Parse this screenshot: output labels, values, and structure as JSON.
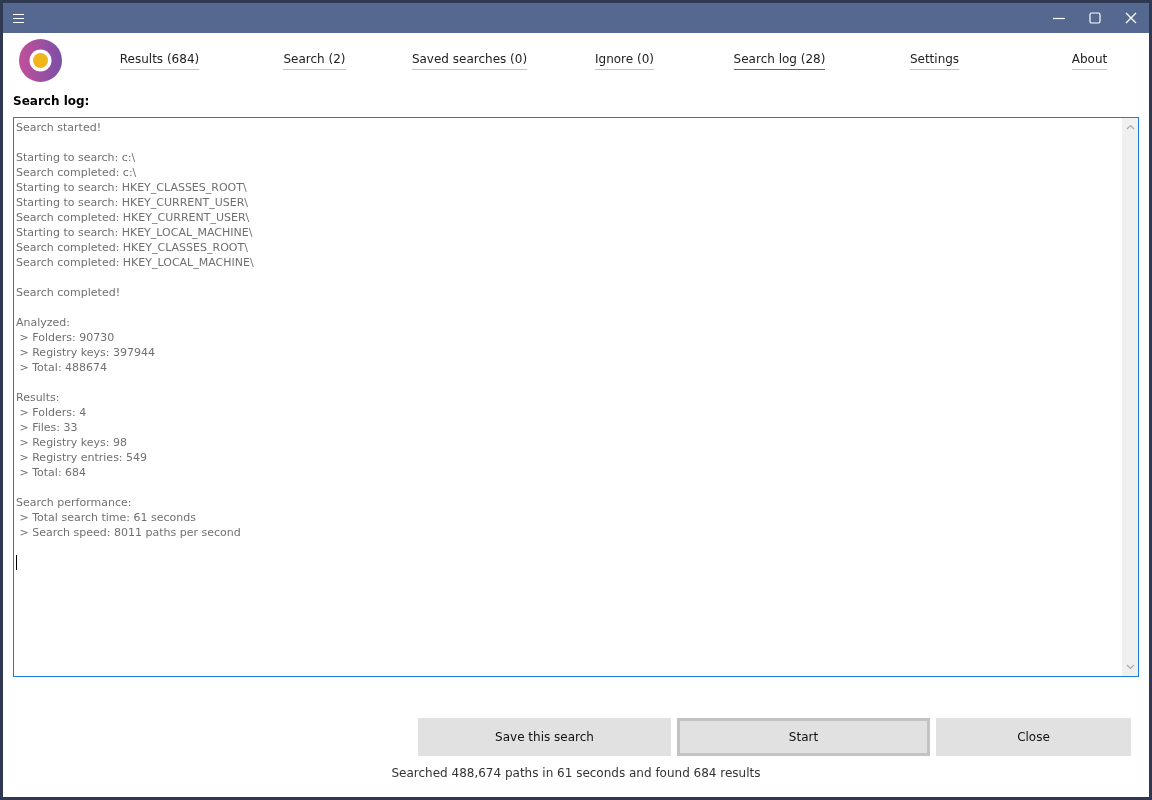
{
  "tabs": [
    {
      "label": "Results (684)",
      "selected": false
    },
    {
      "label": "Search (2)",
      "selected": false
    },
    {
      "label": "Saved searches (0)",
      "selected": false
    },
    {
      "label": "Ignore (0)",
      "selected": false
    },
    {
      "label": "Search log (28)",
      "selected": true
    },
    {
      "label": "Settings",
      "selected": false
    },
    {
      "label": "About",
      "selected": false
    }
  ],
  "heading": "Search log:",
  "log": [
    [
      "Search started!"
    ],
    [
      "Starting to search: c:\\",
      "Search completed: c:\\",
      "Starting to search: HKEY_CLASSES_ROOT\\",
      "Starting to search: HKEY_CURRENT_USER\\",
      "Search completed: HKEY_CURRENT_USER\\",
      "Starting to search: HKEY_LOCAL_MACHINE\\",
      "Search completed: HKEY_CLASSES_ROOT\\",
      "Search completed: HKEY_LOCAL_MACHINE\\"
    ],
    [
      "Search completed!"
    ],
    [
      "Analyzed:",
      " > Folders: 90730",
      " > Registry keys: 397944",
      " > Total: 488674"
    ],
    [
      "Results:",
      " > Folders: 4",
      " > Files: 33",
      " > Registry keys: 98",
      " > Registry entries: 549",
      " > Total: 684"
    ],
    [
      "Search performance:",
      " > Total search time: 61 seconds",
      " > Search speed: 8011 paths per second"
    ]
  ],
  "buttons": [
    {
      "label": "Save this search",
      "default": false
    },
    {
      "label": "Start",
      "default": true
    },
    {
      "label": "Close",
      "default": false
    }
  ],
  "status": "Searched 488,674 paths in 61 seconds and found 684 results"
}
